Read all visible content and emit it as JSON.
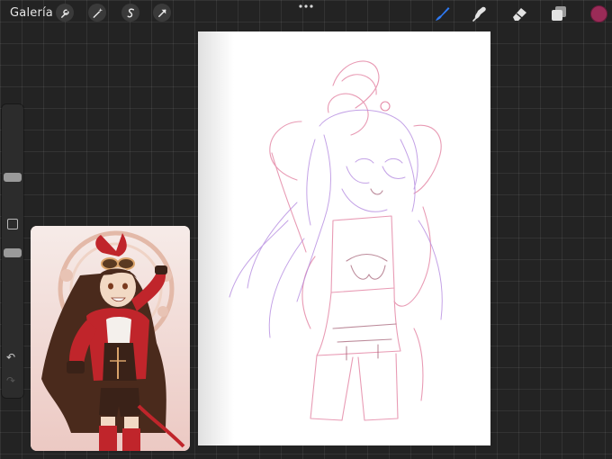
{
  "toolbar": {
    "gallery_label": "Galería",
    "left_tools": [
      "wrench-icon",
      "magic-wand-icon",
      "selection-s-icon",
      "transform-arrow-icon"
    ],
    "right_tools": [
      "brush-icon",
      "smudge-icon",
      "eraser-icon",
      "layers-icon"
    ],
    "active_tool": "brush-icon",
    "active_color": "#9a2b57",
    "accent_color": "#2f7bf5"
  },
  "sidebar": {
    "brush_size_level": 0.25,
    "opacity_level": 0.5,
    "undo_icon": "↶",
    "redo_icon": "↷"
  },
  "canvas": {
    "stroke_colors": [
      "#e58aa8",
      "#b58be0",
      "#a05a70"
    ]
  },
  "reference": {
    "character_colors": [
      "#c0252b",
      "#3a2218",
      "#f2d9c4",
      "#d9a36a"
    ]
  }
}
